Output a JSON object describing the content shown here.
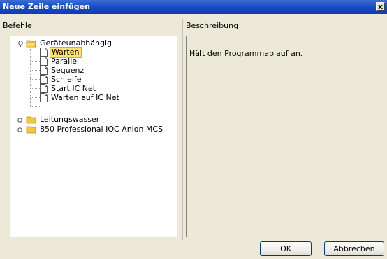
{
  "window": {
    "title": "Neue Zeile einfügen",
    "close_glyph": "x"
  },
  "labels": {
    "commands": "Befehle",
    "description": "Beschreibung"
  },
  "tree": {
    "root": {
      "label": "Geräteunabhängig",
      "expanded": true,
      "children": [
        {
          "label": "Warten",
          "selected": true
        },
        {
          "label": "Parallel"
        },
        {
          "label": "Sequenz"
        },
        {
          "label": "Schleife"
        },
        {
          "label": "Start IC Net"
        },
        {
          "label": "Warten auf IC Net"
        }
      ]
    },
    "collapsed": [
      {
        "label": "Leitungswasser"
      },
      {
        "label": "850 Professional IOC Anion MCS"
      }
    ]
  },
  "description": {
    "text": "Hält den Programmablauf an."
  },
  "buttons": {
    "ok": "OK",
    "cancel": "Abbrechen"
  },
  "colors": {
    "titlebar": "#0b3bb0",
    "selection": "#ffe070",
    "folder": "#f5c542"
  }
}
